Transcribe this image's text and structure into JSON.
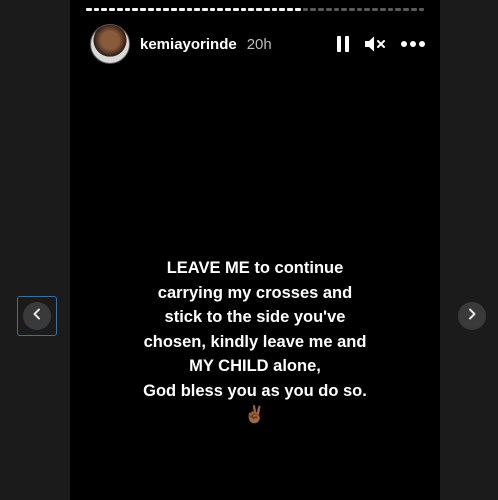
{
  "header": {
    "username": "kemiayorinde",
    "time": "20h"
  },
  "icons": {
    "pause": "pause-icon",
    "mute": "muted-speaker-icon",
    "more": "more-dots-icon",
    "prev": "chevron-left-icon",
    "next": "chevron-right-icon"
  },
  "story": {
    "lines": [
      "LEAVE ME to continue",
      "carrying my crosses and",
      "stick to the side you've",
      "chosen, kindly leave me and",
      "MY CHILD alone,",
      "God bless you as you do so."
    ],
    "emoji": "✌🏾"
  },
  "colors": {
    "background": "#1b1b1b",
    "story_bg": "#000000",
    "text": "#ffffff",
    "focus_outline": "#3d6fa0"
  }
}
